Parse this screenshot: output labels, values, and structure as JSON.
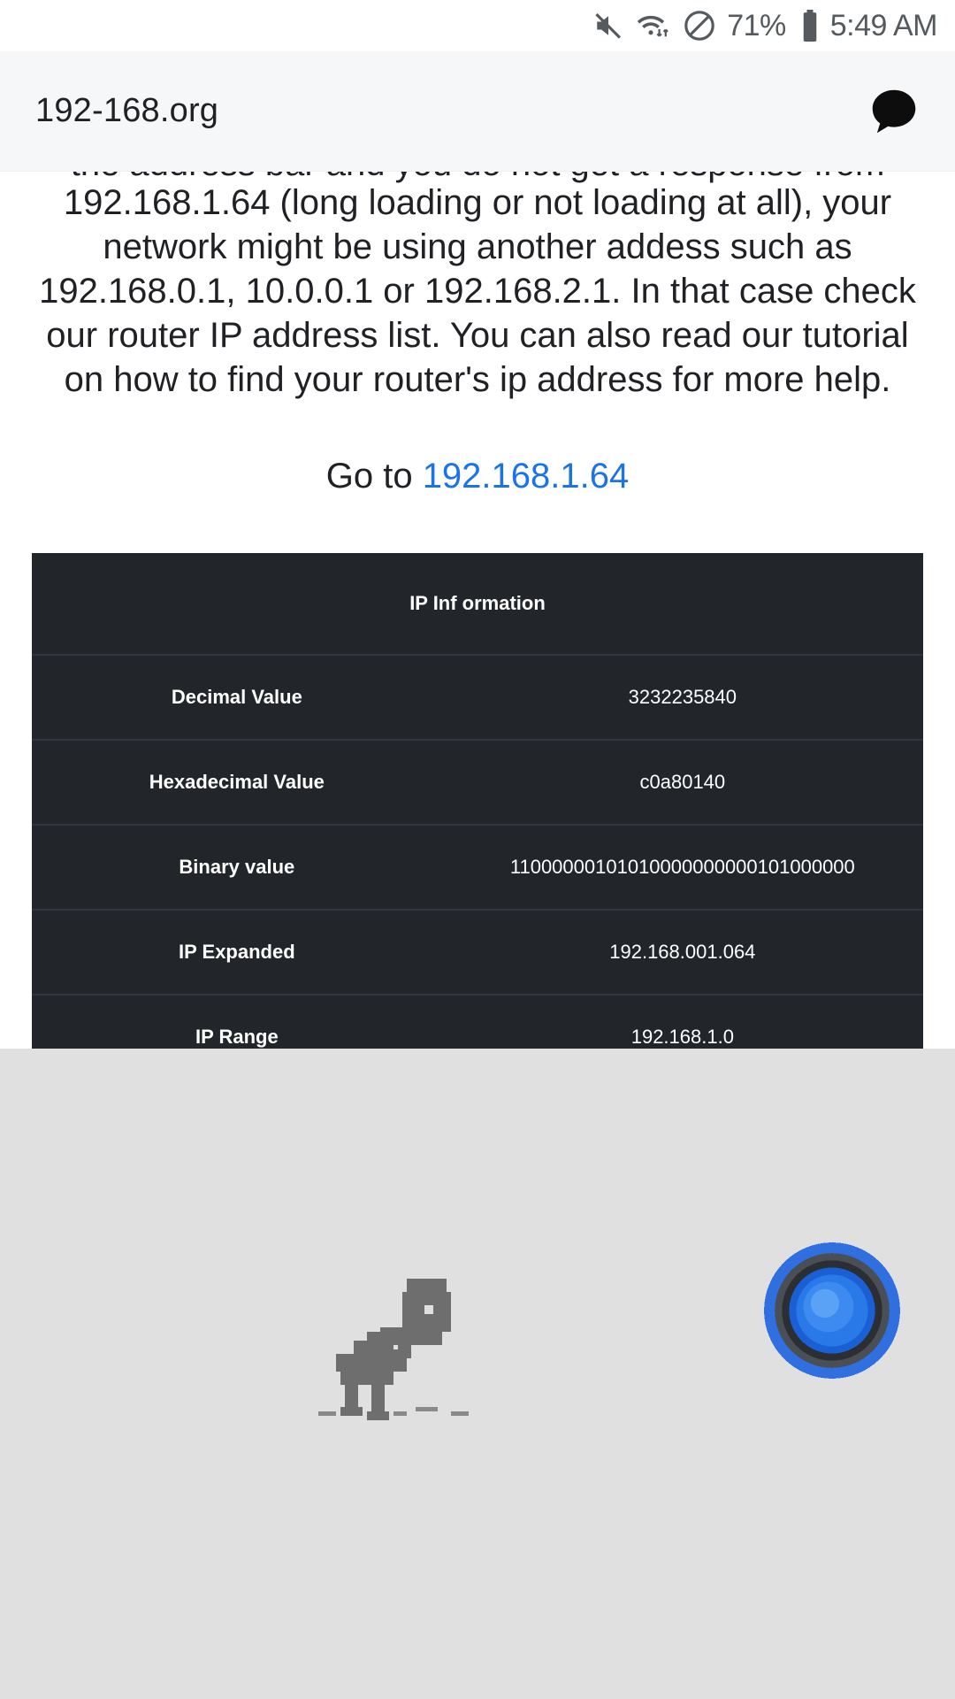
{
  "statusbar": {
    "icons": [
      "mute-icon",
      "wifi-icon",
      "do-not-disturb-icon",
      "battery-icon"
    ],
    "battery_percent": "71%",
    "time": "5:49 AM"
  },
  "browser": {
    "url": "192-168.org",
    "toolbar_icon": "chat-bubble-icon"
  },
  "content": {
    "clipped_line": "the address bar and you do not get a response from",
    "paragraph": "192.168.1.64 (long loading or not loading at all), your network might be using another addess such as 192.168.0.1, 10.0.0.1 or 192.168.2.1. In that case check our router IP address list. You can also read our tutorial on how to find your router's ip address for more help.",
    "goto_prefix": "Go to ",
    "goto_link": "192.168.1.64"
  },
  "table": {
    "header": "IP Inf ormation",
    "rows": [
      {
        "label": "Decimal Value",
        "value": "3232235840"
      },
      {
        "label": "Hexadecimal Value",
        "value": "c0a80140"
      },
      {
        "label": "Binary value",
        "value": "11000000101010000000000101000000"
      },
      {
        "label": "IP Expanded",
        "value": "192.168.001.064"
      },
      {
        "label": "IP Range",
        "value": "192.168.1.0"
      }
    ]
  },
  "bottom": {
    "dino_icon": "dinosaur-icon",
    "orb_icon": "blue-orb-icon"
  },
  "colors": {
    "link": "#1a73e8",
    "table_bg": "#22262b",
    "addressbar_bg": "#f6f7f9",
    "bottom_bg": "#e0e0e0"
  }
}
